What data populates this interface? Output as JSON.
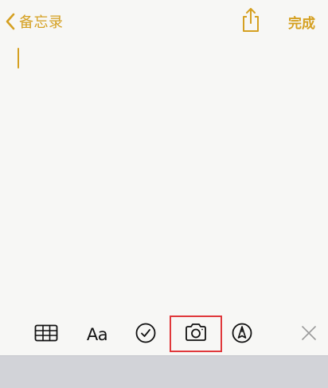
{
  "nav": {
    "back_label": "备忘录",
    "done_label": "完成"
  },
  "colors": {
    "accent": "#d5a021",
    "highlight_box": "#e0383b",
    "background": "#f7f7f5",
    "keyboard": "#d2d3d8"
  },
  "toolbar": {
    "format_label": "Aa",
    "icons": [
      "table-icon",
      "format-text-icon",
      "checklist-icon",
      "camera-icon",
      "markup-icon",
      "close-icon"
    ]
  }
}
